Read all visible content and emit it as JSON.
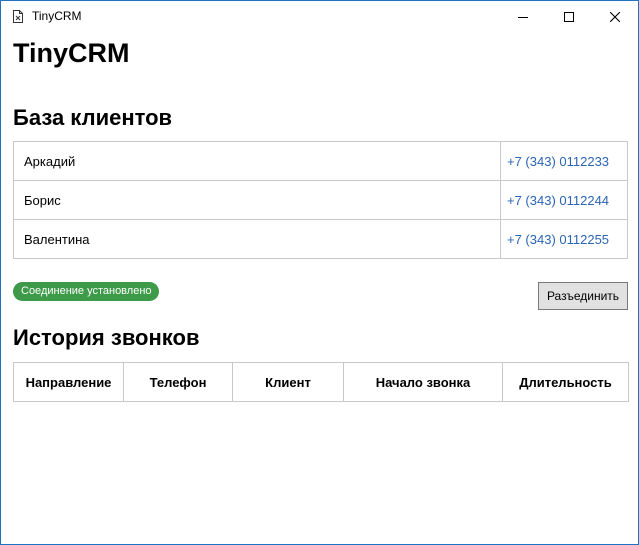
{
  "window": {
    "title": "TinyCRM",
    "controls": [
      "minimize-icon",
      "maximize-icon",
      "close-icon"
    ]
  },
  "app_title": "TinyCRM",
  "clients": {
    "heading": "База клиентов",
    "rows": [
      {
        "name": "Аркадий",
        "phone": "+7 (343) 0112233"
      },
      {
        "name": "Борис",
        "phone": "+7 (343) 0112244"
      },
      {
        "name": "Валентина",
        "phone": "+7 (343) 0112255"
      }
    ]
  },
  "connection": {
    "status": "Соединение установлено",
    "status_color": "#3c9a48",
    "disconnect_label": "Разъединить"
  },
  "history": {
    "heading": "История звонков",
    "columns": [
      "Направление",
      "Телефон",
      "Клиент",
      "Начало звонка",
      "Длительность"
    ]
  },
  "colors": {
    "window_border": "#1e73c6",
    "phone_link": "#2a64b4"
  }
}
